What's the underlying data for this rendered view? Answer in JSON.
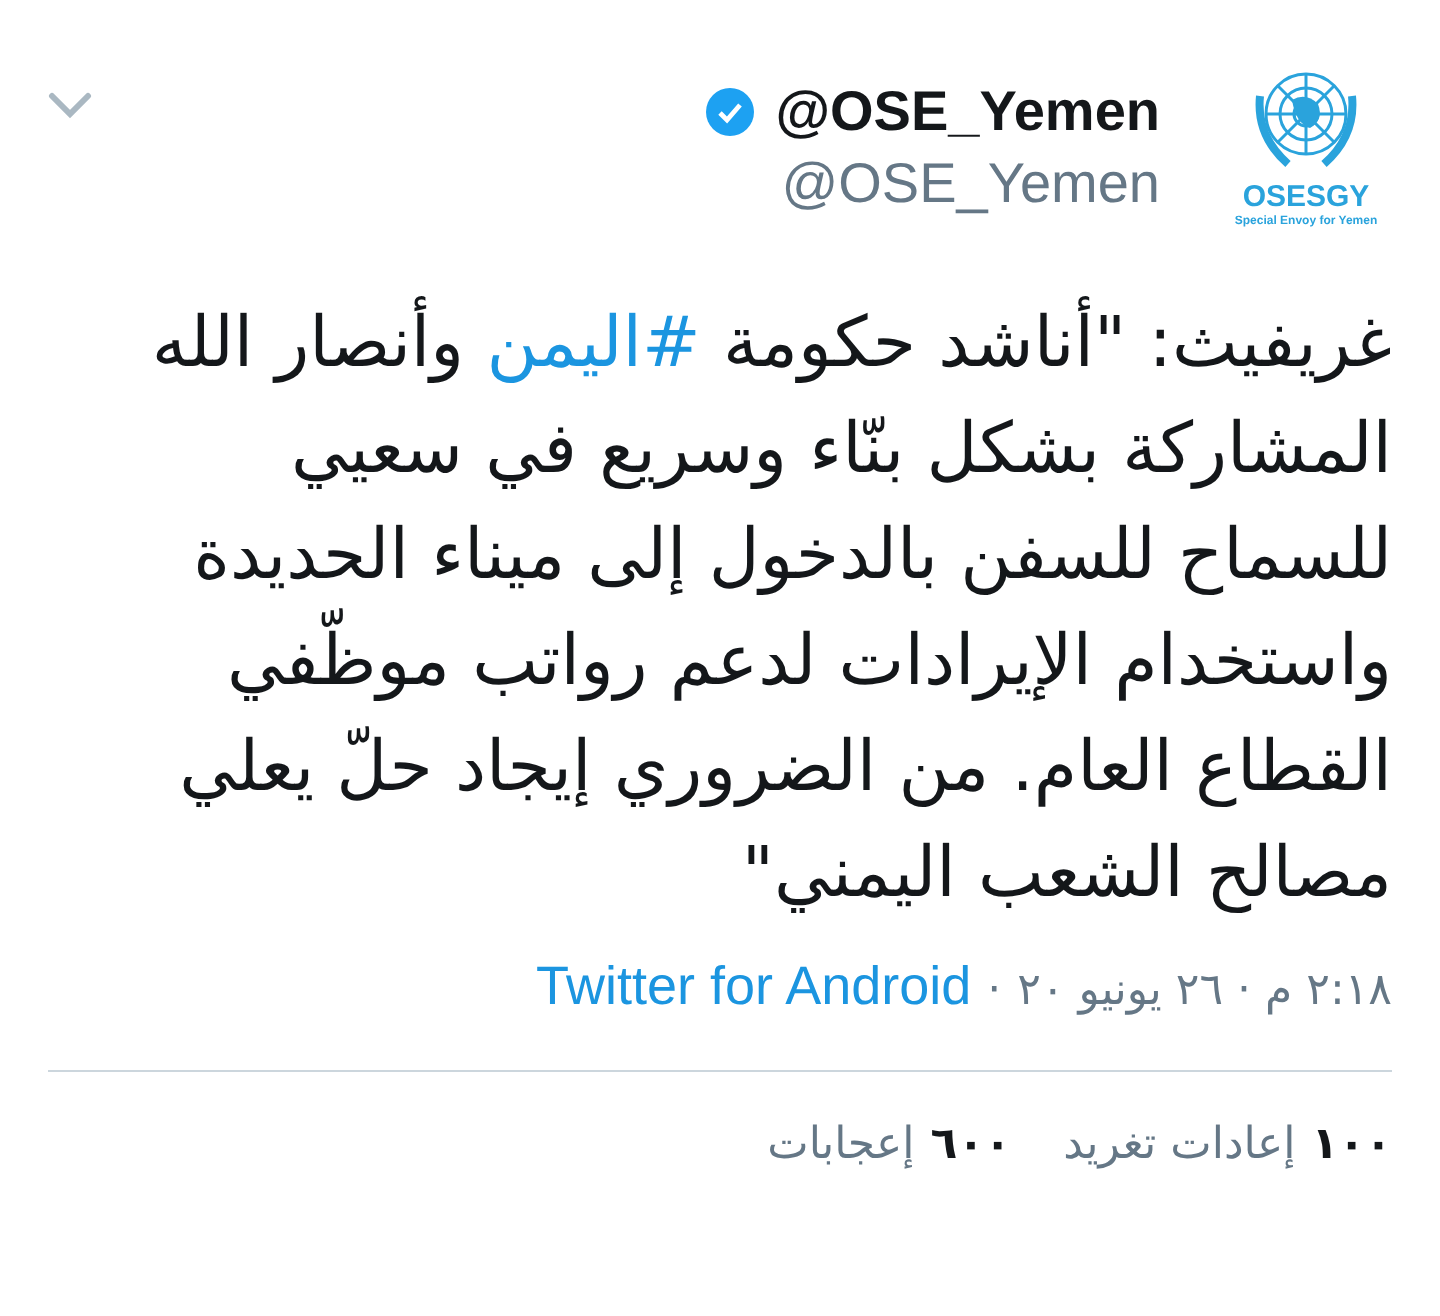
{
  "header": {
    "display_name": "@OSE_Yemen",
    "verified": true,
    "handle": "@OSE_Yemen",
    "avatar": {
      "title": "OSESGY",
      "subtitle": "Special Envoy for Yemen"
    }
  },
  "tweet": {
    "segments": [
      {
        "kind": "text",
        "text": "غريفيث: \"أناشد حكومة "
      },
      {
        "kind": "hashtag",
        "text": "#اليمن"
      },
      {
        "kind": "text",
        "text": " وأنصار الله المشاركة بشكل بنّاء وسريع في سعيي للسماح للسفن بالدخول إلى ميناء الحديدة واستخدام الإيرادات لدعم رواتب موظّفي القطاع العام. من الضروري إيجاد حلّ يعلي مصالح الشعب اليمني\""
      }
    ]
  },
  "meta": {
    "time": "٢:١٨ م · ٢٦ يونيو ٢٠",
    "separator": "·",
    "source": "Twitter for Android"
  },
  "stats": [
    {
      "count": "١٠٠",
      "label": "إعادات تغريد"
    },
    {
      "count": "٦٠٠",
      "label": "إعجابات"
    }
  ]
}
